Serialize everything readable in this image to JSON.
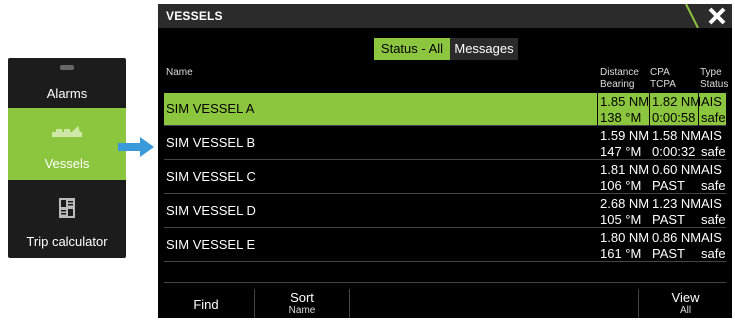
{
  "side_menu": {
    "items": [
      {
        "label": "Alarms",
        "icon": "alarm-icon"
      },
      {
        "label": "Vessels",
        "icon": "vessels-icon",
        "selected": true
      },
      {
        "label": "Trip calculator",
        "icon": "trip-calculator-icon"
      }
    ]
  },
  "window": {
    "title": "VESSELS",
    "close_icon": "close-icon"
  },
  "tabs": [
    {
      "label": "Status - All",
      "active": true
    },
    {
      "label": "Messages",
      "active": false
    }
  ],
  "table": {
    "columns": [
      {
        "line1": "Name",
        "line2": ""
      },
      {
        "line1": "Distance",
        "line2": "Bearing"
      },
      {
        "line1": "CPA",
        "line2": "TCPA"
      },
      {
        "line1": "Type",
        "line2": "Status"
      }
    ],
    "rows": [
      {
        "name": "SIM VESSEL A",
        "distance": "1.85 NM",
        "bearing": "138 °M",
        "cpa": "1.82 NM",
        "tcpa": "0:00:58",
        "type": "AIS",
        "status": "safe",
        "selected": true
      },
      {
        "name": "SIM VESSEL B",
        "distance": "1.59 NM",
        "bearing": "147 °M",
        "cpa": "1.58 NM",
        "tcpa": "0:00:32",
        "type": "AIS",
        "status": "safe"
      },
      {
        "name": "SIM VESSEL C",
        "distance": "1.81 NM",
        "bearing": "106 °M",
        "cpa": "0.60 NM",
        "tcpa": "PAST",
        "type": "AIS",
        "status": "safe"
      },
      {
        "name": "SIM VESSEL D",
        "distance": "2.68 NM",
        "bearing": "105 °M",
        "cpa": "1.23 NM",
        "tcpa": "PAST",
        "type": "AIS",
        "status": "safe"
      },
      {
        "name": "SIM VESSEL E",
        "distance": "1.80 NM",
        "bearing": "161 °M",
        "cpa": "0.86 NM",
        "tcpa": "PAST",
        "type": "AIS",
        "status": "safe"
      }
    ]
  },
  "footer": {
    "find_label": "Find",
    "sort_label": "Sort",
    "sort_value": "Name",
    "view_label": "View",
    "view_value": "All"
  },
  "colors": {
    "accent": "#8cc63f",
    "arrow": "#3a9ad9",
    "panel_bg": "#000000",
    "bar_bg": "#2b2b2b"
  }
}
